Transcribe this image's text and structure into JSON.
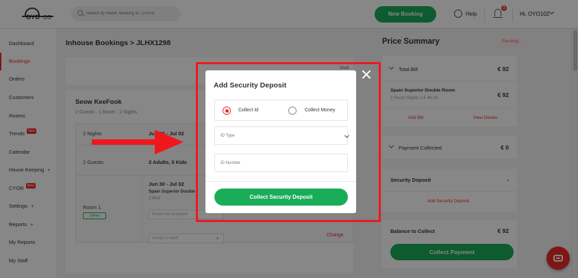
{
  "header": {
    "logo_text": "OYO",
    "logo_suffix": "OS",
    "search_placeholder": "Search by Name, Booking ID, OTA ID",
    "new_booking_label": "New Booking",
    "help_label": "Help",
    "notification_count": "3",
    "user_label": "Hi, OYO102"
  },
  "sidebar": {
    "items": [
      {
        "label": "Dashboard"
      },
      {
        "label": "Bookings",
        "active": true
      },
      {
        "label": "Orders"
      },
      {
        "label": "Customers"
      },
      {
        "label": "Rooms"
      },
      {
        "label": "Trends",
        "badge": "New"
      },
      {
        "label": "Calendar"
      },
      {
        "label": "House Keeping",
        "suffix": "+"
      },
      {
        "label": "CYOR",
        "badge": "New"
      },
      {
        "label": "Settings",
        "suffix": "+"
      },
      {
        "label": "Reports",
        "suffix": "+"
      },
      {
        "label": "My Reports"
      },
      {
        "label": "My Staff"
      }
    ]
  },
  "main": {
    "breadcrumb": "Inhouse Bookings > JLHX1298",
    "walk_in": "Walk In",
    "guest_name": "Seow KeeFook",
    "guest_summary": "2 Guests . 1 Room . 2 Nights",
    "nights": "2 Nights",
    "dates": "Jun 30 - Jul 02",
    "guests": "2 Guests",
    "guest_breakdown": "2 Adults, 0 Kids",
    "room_dates": "Jun 30 - Jul 02",
    "room_type": "Spain Superior Double",
    "room_pax": "2 PAX",
    "room_label": "Room 1",
    "room_status": "Clean",
    "assign_room_placeholder": "Assign 1 Adult",
    "room_field_placeholder": "Room not assigned",
    "change_label": "Change"
  },
  "price_summary": {
    "title": "Price Summary",
    "status": "Pending",
    "total_bill_label": "Total Bill",
    "total_bill_value": "€ 92",
    "room_line_label": "Spain Superior Double Room",
    "room_line_sub": "2 Room Nights x € 46.00",
    "room_line_value": "€ 92",
    "add_bill": "Add Bill",
    "view_details": "View Details",
    "payment_collected_label": "Payment Collected",
    "payment_collected_value": "€ 0",
    "security_deposit_label": "Security Deposit",
    "security_deposit_value": "-",
    "add_security_deposit": "Add Security Deposit",
    "balance_label": "Balance to Collect",
    "balance_value": "€ 92",
    "collect_payment": "Collect Payment"
  },
  "modal": {
    "title": "Add Security Deposit",
    "option_collect_id": "Collect Id",
    "option_collect_money": "Collect Money",
    "selected_option": "Collect Id",
    "id_type_placeholder": "ID Type",
    "id_number_placeholder": "ID Number",
    "submit_label": "Collect Security Deposit"
  },
  "colors": {
    "brand_red": "#ee2a24",
    "primary_green": "#1aad58",
    "annotation_red": "#f0171c"
  }
}
